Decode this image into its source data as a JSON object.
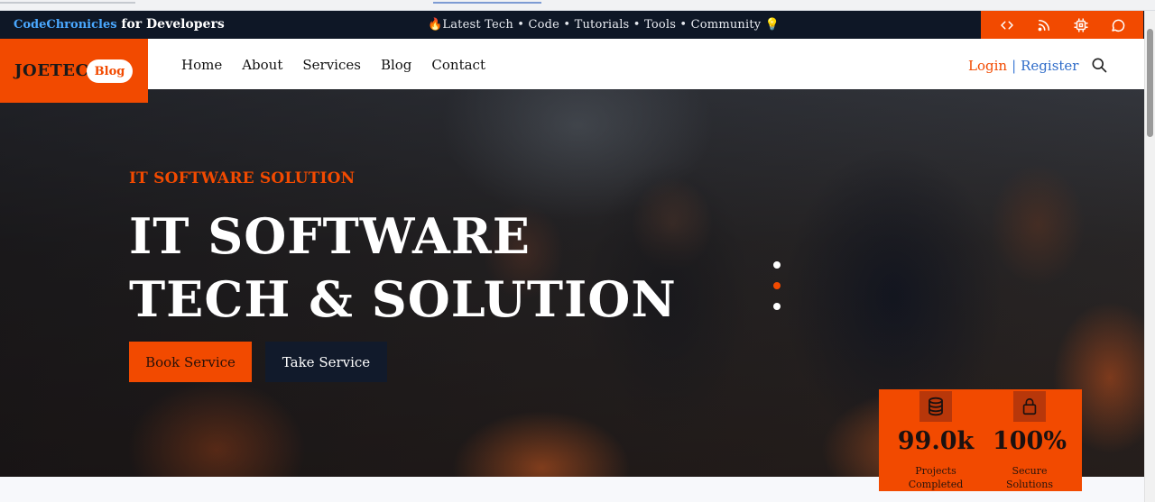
{
  "topbar": {
    "brand_accent": "CodeChronicles",
    "brand_rest": " for Developers",
    "ticker": "🔥Latest Tech • Code • Tutorials • Tools • Community 💡",
    "icons": [
      "code-icon",
      "rss-icon",
      "chip-icon",
      "chat-icon"
    ]
  },
  "logo": {
    "text": "JOETEC",
    "badge": "Blog"
  },
  "nav": {
    "links": [
      "Home",
      "About",
      "Services",
      "Blog",
      "Contact"
    ],
    "login": "Login",
    "separator": "|",
    "register": "Register"
  },
  "hero": {
    "subtitle": "IT SOFTWARE SOLUTION",
    "title_line1": "IT SOFTWARE",
    "title_line2": "TECH & SOLUTION",
    "primary_button": "Book Service",
    "secondary_button": "Take Service",
    "slides_total": 3,
    "active_slide": 2
  },
  "stats": [
    {
      "icon": "database-icon",
      "value": "99.0k",
      "label_line1": "Projects",
      "label_line2": "Completed"
    },
    {
      "icon": "lock-icon",
      "value": "100%",
      "label_line1": "Secure",
      "label_line2": "Solutions"
    }
  ],
  "colors": {
    "accent": "#f24a00",
    "topbar_bg": "#0e1726",
    "link_blue": "#2f6cc9",
    "dark_button": "#111a2b"
  }
}
